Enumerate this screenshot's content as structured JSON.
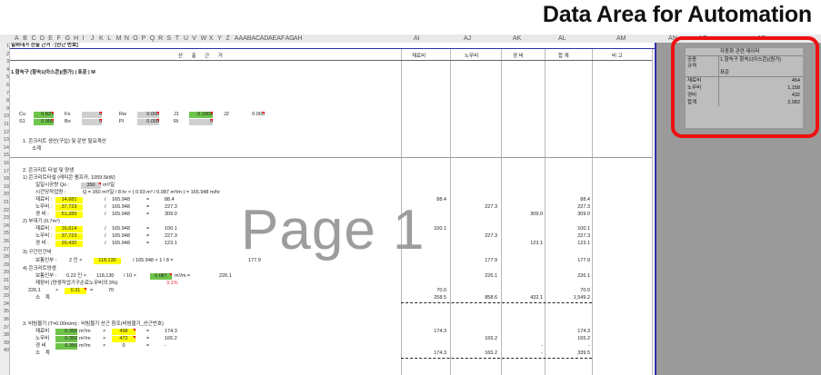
{
  "title": "Data Area for Automation",
  "page_label": "Page 1",
  "columns": [
    "A",
    "B",
    "C",
    "D",
    "E",
    "F",
    "G",
    "H",
    "I",
    "J",
    "K",
    "L",
    "M",
    "N",
    "O",
    "P",
    "Q",
    "R",
    "S",
    "T",
    "U",
    "V",
    "W",
    "X",
    "Y",
    "Z",
    "AA",
    "AB",
    "AC",
    "AD",
    "AE",
    "AF",
    "AG",
    "AH",
    "AI",
    "AJ",
    "AK",
    "AL",
    "AM",
    "AN",
    "AO",
    "AP"
  ],
  "row_numbers": [
    "1",
    "2",
    "3",
    "4",
    "5",
    "6",
    "7",
    "8",
    "9",
    "10",
    "11",
    "12",
    "13",
    "14",
    "15",
    "16",
    "17",
    "18",
    "19",
    "20",
    "21",
    "22",
    "23",
    "24",
    "25",
    "26",
    "27",
    "28",
    "29",
    "30",
    "31",
    "32",
    "33",
    "34",
    "35",
    "36",
    "37",
    "38",
    "39",
    "40"
  ],
  "sheet": {
    "row1_title": "일위대가 산출 근거 : [산근 번호]",
    "header": {
      "main": "산 출 근 거",
      "col_material": "재료비",
      "col_labor": "노무비",
      "col_expense": "경 비",
      "col_total": "합 계",
      "col_note": "비 고"
    },
    "row4": "1.항속구 (항속1(아스콘)(원가) | 표준 | M",
    "params": {
      "cu_label": "Cu",
      "cu": "0.837",
      "fo_label": "Fo",
      "fo": "0",
      "rw_label": "Rw",
      "rw": "0.000",
      "j1_label": "J1",
      "j1": "0.1803",
      "j2_label": "J2",
      "j2": "0.000",
      "s1_label": "S1",
      "s1": "0.950",
      "bo_label": "Bo",
      "bo": "0",
      "pl_label": "Pl",
      "pl": "0.000",
      "ri_label": "Ri",
      "ri": "0"
    },
    "sec1": "1. 콘크리트 생산(구입) 및 운반 필요계산",
    "sec1_sub": "소계",
    "sec2": "2. 콘크리트 타설 및 양생",
    "sec2_1": "1) 콘크리트타설 (레미콘 펌프카, 1059.5kW)",
    "sec2_1a": "일일시공량 Qo :",
    "sec2_1a_val": "350",
    "sec2_1a_unit": "m³/일",
    "sec2_1b": "시간당작업량 :",
    "sec2_1b_formula": "Q = 350 m³/일 / 8 hr × ( 0.93 m³ / 0.087 m³/m ) = 165.948 m/hr",
    "r20": {
      "lbl": "재료비 :",
      "v": "14,681",
      "div": "/",
      "q": "165.948",
      "eq": "=",
      "res": "88.4",
      "mat": "88.4",
      "tot": "88.4"
    },
    "r21": {
      "lbl": "노무비 :",
      "v": "37,723",
      "div": "/",
      "q": "165.948",
      "eq": "=",
      "res": "227.3",
      "lab": "227.3",
      "tot": "227.3"
    },
    "r22": {
      "lbl": "경 비 :",
      "v": "51,289",
      "div": "/",
      "q": "165.948",
      "eq": "=",
      "res": "309.0",
      "exp": "309.0",
      "tot": "309.0"
    },
    "sec2_2": "2) 부대기 (0.7m³)",
    "r24": {
      "lbl": "재료비 :",
      "v": "16,614",
      "div": "/",
      "q": "165.948",
      "eq": "=",
      "res": "100.1",
      "mat": "100.1",
      "tot": "100.1"
    },
    "r25": {
      "lbl": "노무비 :",
      "v": "37,723",
      "div": "/",
      "q": "165.948",
      "eq": "=",
      "res": "227.3",
      "lab": "227.3",
      "tot": "227.3"
    },
    "r26": {
      "lbl": "경 비 :",
      "v": "20,430",
      "div": "/",
      "q": "165.948",
      "eq": "=",
      "res": "123.1",
      "exp": "123.1",
      "tot": "123.1"
    },
    "sec2_3": "3) 구간인건비",
    "r28": {
      "lbl": "보통인부 :",
      "v1": "2 인 ×",
      "v": "118,130",
      "d": "/ 165.948 × 1 / 8 =",
      "res": "177.9",
      "lab": "177.9",
      "tot": "177.9"
    },
    "sec2_4": "4) 콘크리트양생",
    "r30": {
      "lbl": "보통인부 :",
      "f1": "0.22 인 ×",
      "v": "118,130",
      "f2": "/ 10 ×",
      "v2": "0.087",
      "f3": "m³/m =",
      "res": "226.1",
      "lab": "226.1",
      "tot": "226.1"
    },
    "r31": "재장비 (양생작업기구손료노무비의 3%)",
    "r31_pct": "3.1%",
    "r32": {
      "v": "226.1",
      "x": "×",
      "pct": "0.31",
      "eq": "=",
      "res": "70",
      "mat": "70.0",
      "tot": "70.0"
    },
    "r33": {
      "lbl": "소 계",
      "mat": "258.5",
      "lab": "858.6",
      "exp": "432.1",
      "tot": "1,549.2"
    },
    "sec3": "3. 비빔물기 (T=0.00m/m) : 비빔물기 산근 참조(비빔물기_산근번호)",
    "r36": {
      "lbl": "재료비",
      "coef": "0.350",
      "unit": "m²/m",
      "x": "×",
      "v": "498",
      "eq": "=",
      "res": "174.3",
      "mat": "174.3",
      "tot": "174.3"
    },
    "r37": {
      "lbl": "노무비",
      "coef": "0.350",
      "unit": "m²/m",
      "x": "×",
      "v": "472",
      "eq": "=",
      "res": "165.2",
      "lab": "165.2",
      "tot": "165.2"
    },
    "r38": {
      "lbl": "경 비",
      "coef": "0.350",
      "unit": "m²/m",
      "x": "×",
      "v": "0",
      "eq": "=",
      "res": "-",
      "exp": "-",
      "tot": "-"
    },
    "r39": {
      "lbl": "소 계",
      "mat": "174.3",
      "lab": "165.2",
      "exp": "-",
      "tot": "339.5"
    }
  },
  "automation": {
    "header": "자동화 관련 데이터",
    "rows": [
      {
        "k": "공종",
        "v": "1.항속구 항속1(아스콘)(원가)"
      },
      {
        "k": "규격",
        "v": "표준"
      },
      {
        "k": "재료비",
        "v": "454"
      },
      {
        "k": "노무비",
        "v": "1,158"
      },
      {
        "k": "경비",
        "v": "432"
      },
      {
        "k": "합계",
        "v": "2,082"
      }
    ]
  },
  "colors": {
    "accent_red": "#ee1111",
    "highlight_yellow": "#ffff00",
    "highlight_green": "#6ec44a",
    "border_blue": "#2e2ea8",
    "gray_area": "#9a9a9a"
  }
}
